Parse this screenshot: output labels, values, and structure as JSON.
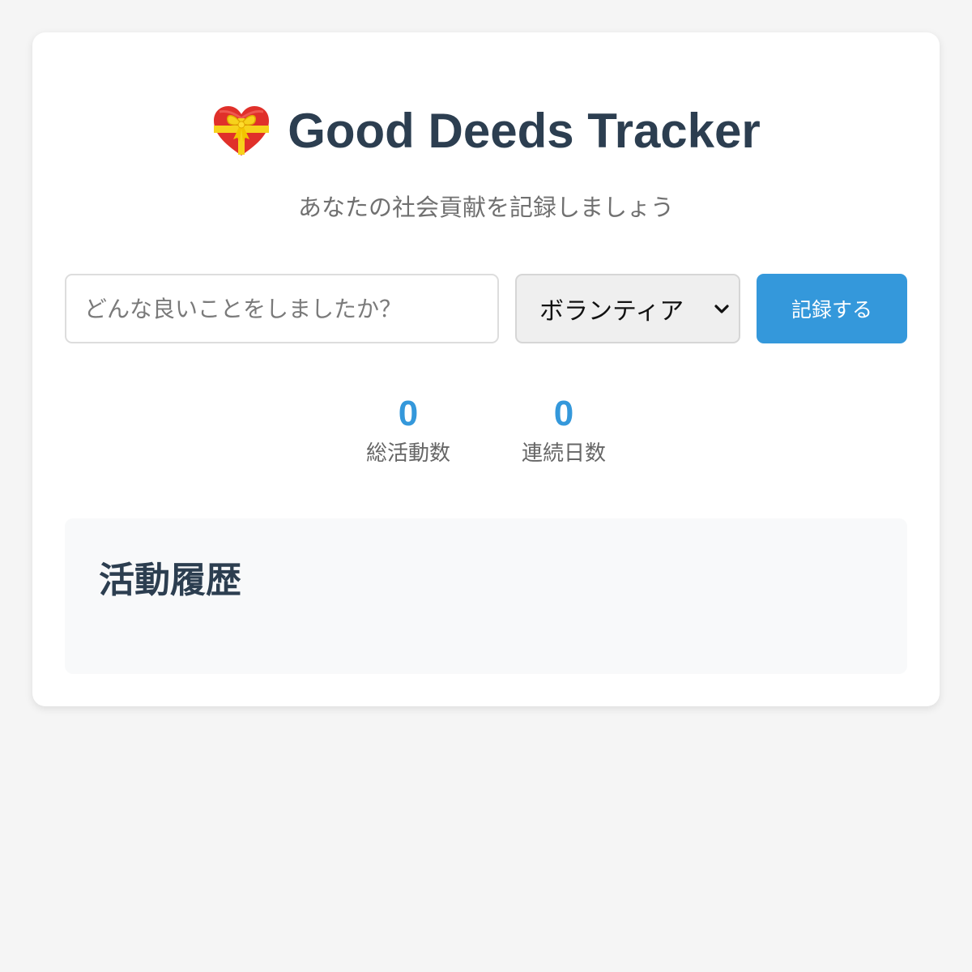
{
  "header": {
    "icon": "gift-heart-icon",
    "title": "Good Deeds Tracker",
    "subtitle": "あなたの社会貢献を記録しましょう"
  },
  "form": {
    "deed_placeholder": "どんな良いことをしましたか？",
    "deed_value": "",
    "category_selected": "ボランティア",
    "record_label": "記録する"
  },
  "stats": {
    "total_value": "0",
    "total_label": "総活動数",
    "streak_value": "0",
    "streak_label": "連続日数"
  },
  "history": {
    "title": "活動履歴",
    "items": []
  },
  "colors": {
    "accent": "#3498db",
    "heading": "#2c3e50",
    "background": "#f5f5f5"
  }
}
